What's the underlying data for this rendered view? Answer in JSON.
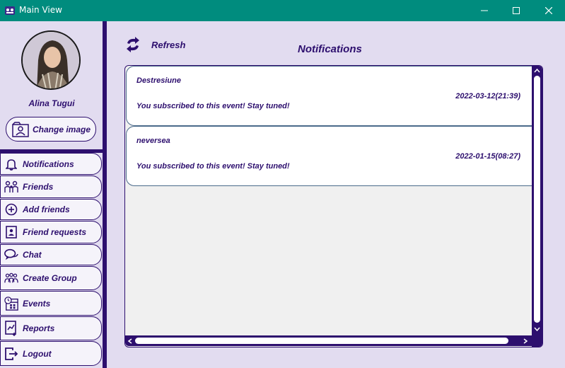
{
  "window": {
    "title": "Main View",
    "accent_color": "#008c7e",
    "primary_color": "#2d0f6e"
  },
  "sidebar": {
    "user_name": "Alina Tugui",
    "change_image_label": "Change image",
    "items": [
      {
        "label": "Notifications",
        "icon": "bell-icon"
      },
      {
        "label": "Friends",
        "icon": "friends-icon"
      },
      {
        "label": "Add friends",
        "icon": "add-circle-icon"
      },
      {
        "label": "Friend requests",
        "icon": "request-doc-icon"
      },
      {
        "label": "Chat",
        "icon": "chat-icon"
      },
      {
        "label": "Create Group",
        "icon": "group-icon"
      },
      {
        "label": "Events",
        "icon": "calendar-icon"
      },
      {
        "label": "Reports",
        "icon": "report-icon"
      },
      {
        "label": "Logout",
        "icon": "logout-icon"
      }
    ]
  },
  "main": {
    "refresh_label": "Refresh",
    "title": "Notifications",
    "notifications": [
      {
        "event": "Destresiune",
        "date": "2022-03-12(21:39)",
        "message": "You subscribed to this event! Stay tuned!"
      },
      {
        "event": "neversea",
        "date": "2022-01-15(08:27)",
        "message": "You subscribed to this event! Stay tuned!"
      }
    ]
  }
}
